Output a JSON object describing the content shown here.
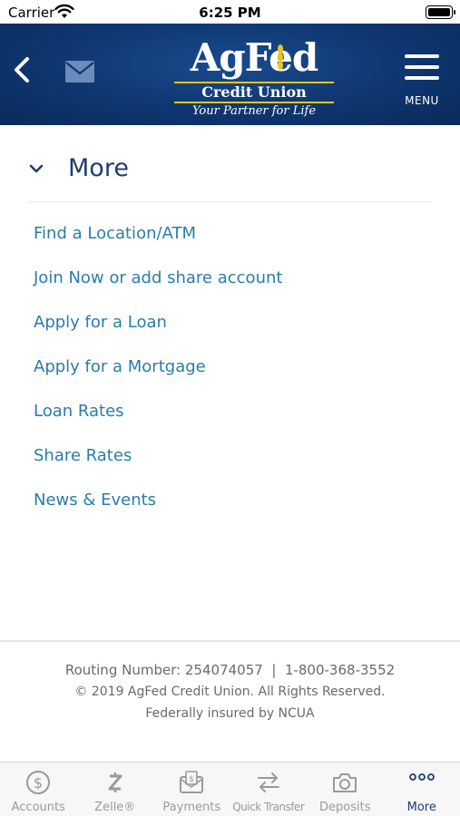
{
  "status_bar": {
    "carrier": "Carrier",
    "time": "6:25 PM"
  },
  "header": {
    "logo": {
      "name": "AgFed",
      "subtitle": "Credit Union",
      "tagline": "Your Partner for Life"
    },
    "menu_label": "MENU",
    "colors": {
      "background": "#0e3670",
      "logo_accent": "#f2c318",
      "mail_icon": "#6b8bb8"
    }
  },
  "section": {
    "title": "More",
    "items": [
      {
        "label": "Find a Location/ATM"
      },
      {
        "label": "Join Now or add share account"
      },
      {
        "label": "Apply for a Loan"
      },
      {
        "label": "Apply for a Mortgage"
      },
      {
        "label": "Loan Rates"
      },
      {
        "label": "Share Rates"
      },
      {
        "label": "News & Events"
      }
    ],
    "colors": {
      "title": "#1f3d73",
      "link": "#2a7da9"
    }
  },
  "footer": {
    "routing": "Routing Number: 254074057  |  1-800-368-3552",
    "copyright": "© 2019 AgFed Credit Union. All Rights Reserved.",
    "insured": "Federally insured by NCUA"
  },
  "tab_bar": {
    "tabs": [
      {
        "label": "Accounts",
        "icon": "dollar-circle-icon",
        "active": false
      },
      {
        "label": "Zelle®",
        "icon": "zelle-icon",
        "active": false
      },
      {
        "label": "Payments",
        "icon": "payment-envelope-icon",
        "active": false
      },
      {
        "label": "Quick Transfer",
        "icon": "transfer-arrows-icon",
        "active": false
      },
      {
        "label": "Deposits",
        "icon": "camera-icon",
        "active": false
      },
      {
        "label": "More",
        "icon": "more-dots-icon",
        "active": true
      }
    ],
    "colors": {
      "active": "#1f3d73",
      "inactive": "#9a9a9a"
    }
  }
}
